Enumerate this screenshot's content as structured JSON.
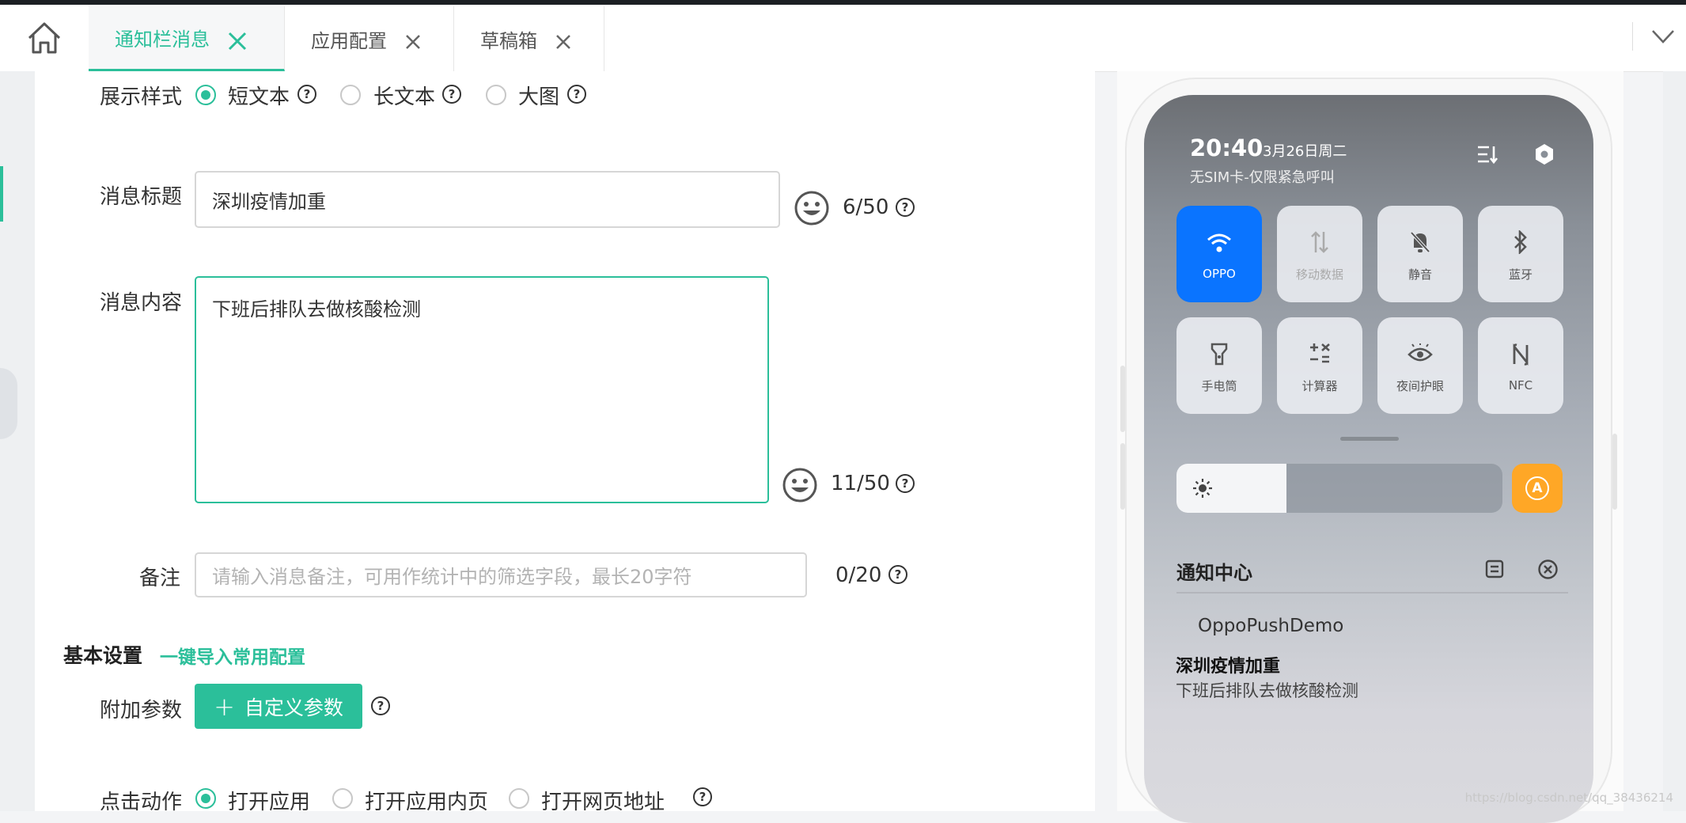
{
  "tabs": [
    {
      "label": "通知栏消息",
      "active": true
    },
    {
      "label": "应用配置",
      "active": false
    },
    {
      "label": "草稿箱",
      "active": false
    }
  ],
  "form": {
    "display_style": {
      "label": "展示样式",
      "options": [
        "短文本",
        "长文本",
        "大图"
      ],
      "selected": "短文本"
    },
    "title": {
      "label": "消息标题",
      "value": "深圳疫情加重",
      "count": "6/50"
    },
    "content": {
      "label": "消息内容",
      "value": "下班后排队去做核酸检测",
      "count": "11/50"
    },
    "remark": {
      "label": "备注",
      "placeholder": "请输入消息备注，可用作统计中的筛选字段，最长20字符",
      "count": "0/20"
    },
    "basic_settings": {
      "title": "基本设置",
      "import_link": "一键导入常用配置"
    },
    "extra_params": {
      "label": "附加参数",
      "button": "自定义参数",
      "button_icon": "+"
    },
    "click_action": {
      "label": "点击动作",
      "options": [
        "打开应用",
        "打开应用内页",
        "打开网页地址"
      ],
      "selected": "打开应用"
    }
  },
  "phone": {
    "time": "20:40",
    "date": "3月26日周二",
    "sim_status": "无SIM卡-仅限紧急呼叫",
    "tiles": [
      {
        "label": "OPPO",
        "icon": "wifi-icon",
        "on": true
      },
      {
        "label": "移动数据",
        "icon": "mobile-data-icon",
        "on": false
      },
      {
        "label": "静音",
        "icon": "bell-off-icon",
        "on": false
      },
      {
        "label": "蓝牙",
        "icon": "bluetooth-icon",
        "on": false
      },
      {
        "label": "手电筒",
        "icon": "flashlight-icon",
        "on": false
      },
      {
        "label": "计算器",
        "icon": "calculator-icon",
        "on": false
      },
      {
        "label": "夜间护眼",
        "icon": "eye-icon",
        "on": false
      },
      {
        "label": "NFC",
        "icon": "nfc-icon",
        "on": false
      }
    ],
    "auto_brightness_glyph": "A",
    "notification_center_title": "通知中心",
    "notification": {
      "app_name": "OppoPushDemo",
      "title": "深圳疫情加重",
      "body": "下班后排队去做核酸检测"
    }
  },
  "watermark": "https://blog.csdn.net/qq_38436214",
  "colors": {
    "accent": "#2bbf9a",
    "tile_active": "#0a74ff",
    "auto_brightness": "#ffa726"
  }
}
